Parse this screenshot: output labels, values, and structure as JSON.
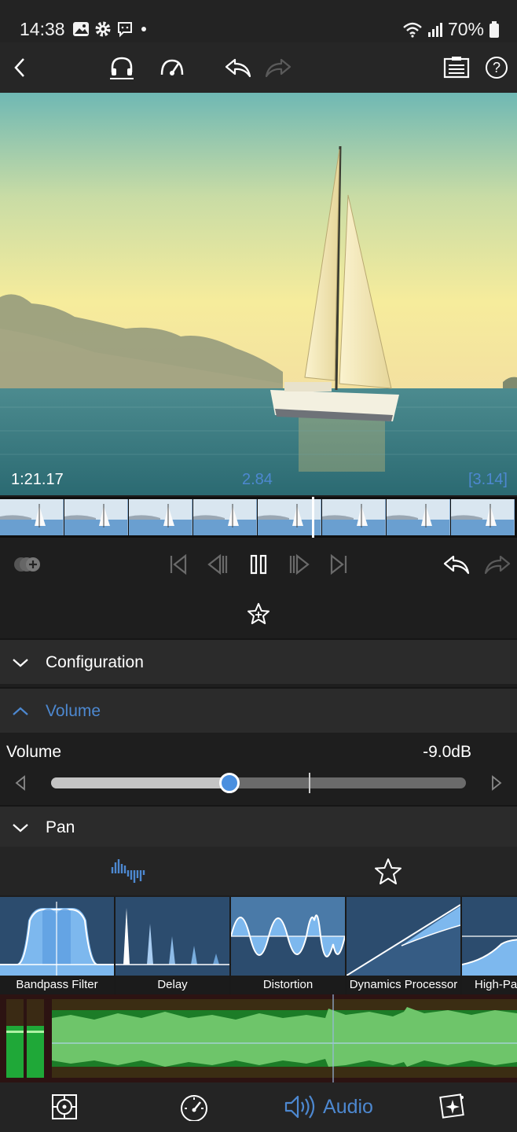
{
  "status_bar": {
    "time": "14:38",
    "battery": "70%",
    "icons": [
      "gallery-icon",
      "settings-gear-icon",
      "message-icon",
      "dot-icon",
      "wifi-icon",
      "signal-icon",
      "battery-icon"
    ]
  },
  "toolbar": {
    "icons": [
      "back-chevron-icon",
      "headphones-icon",
      "speed-gauge-icon",
      "undo-icon",
      "redo-icon",
      "clipboard-icon",
      "help-icon"
    ],
    "help_glyph": "?"
  },
  "preview": {
    "timecode_current": "1:21.17",
    "timecode_clip": "2.84",
    "timecode_total": "[3.14]"
  },
  "transport": {
    "icons": [
      "add-track-icon",
      "skip-to-start-icon",
      "step-back-icon",
      "pause-icon",
      "step-forward-icon",
      "skip-to-end-icon",
      "undo-icon",
      "redo-icon"
    ]
  },
  "favorites": {
    "icon": "star-plus-icon"
  },
  "sections": {
    "configuration": "Configuration",
    "volume": "Volume",
    "pan": "Pan"
  },
  "volume": {
    "label": "Volume",
    "value": "-9.0dB",
    "level": 0.43
  },
  "effects": {
    "tabs": [
      "audio-effects-icon",
      "favorites-star-icon"
    ],
    "items": [
      {
        "label": "Bandpass Filter"
      },
      {
        "label": "Delay"
      },
      {
        "label": "Distortion"
      },
      {
        "label": "Dynamics Processor"
      },
      {
        "label": "High-Pass"
      }
    ]
  },
  "bottom_nav": {
    "items": [
      "target-icon",
      "speedometer-icon",
      "audio-icon",
      "sparkle-icon"
    ],
    "active_label": "Audio"
  },
  "colors": {
    "accent": "#4d88d0",
    "background": "#1e1e1e",
    "panel": "#2b2b2b",
    "thumb": "#4a8fdf"
  }
}
